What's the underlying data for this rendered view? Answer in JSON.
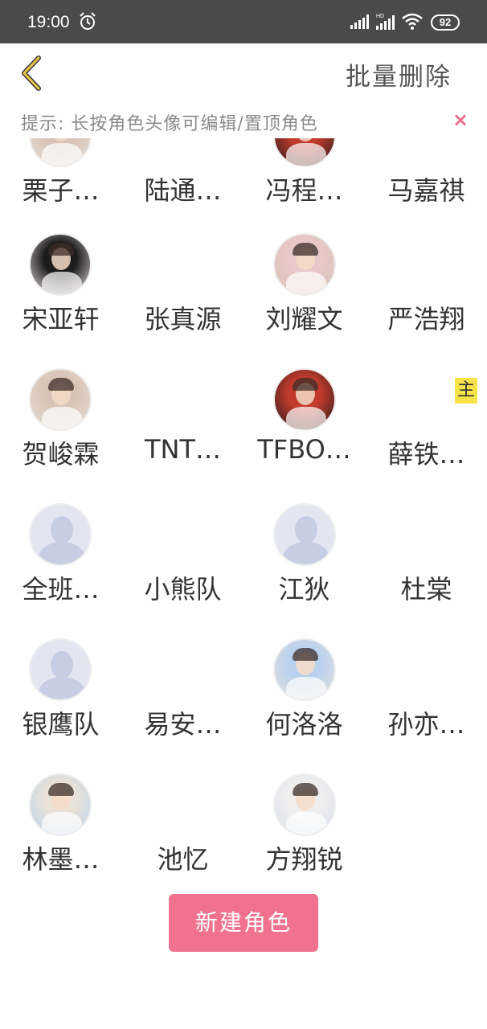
{
  "status_bar": {
    "time": "19:00",
    "battery": "92",
    "alarm_icon": "alarm-clock-icon",
    "signal_icon": "cell-signal-icon",
    "hd_label": "HD",
    "wifi_icon": "wifi-icon"
  },
  "header": {
    "back_icon": "chevron-left-icon",
    "back_color": "#e8c84a",
    "batch_delete_label": "批量删除"
  },
  "tip": {
    "text": "提示: 长按角色头像可编辑/置顶角色",
    "close_symbol": "×",
    "close_color": "#f06f8a"
  },
  "roles": [
    {
      "name": "栗子…",
      "avatar": "photo",
      "badge": ""
    },
    {
      "name": "陆通…",
      "avatar": "photo",
      "badge": ""
    },
    {
      "name": "冯程…",
      "avatar": "photo",
      "badge": ""
    },
    {
      "name": "马嘉祺",
      "avatar": "photo",
      "badge": ""
    },
    {
      "name": "宋亚轩",
      "avatar": "photo",
      "badge": ""
    },
    {
      "name": "张真源",
      "avatar": "photo",
      "badge": ""
    },
    {
      "name": "刘耀文",
      "avatar": "photo",
      "badge": ""
    },
    {
      "name": "严浩翔",
      "avatar": "photo",
      "badge": ""
    },
    {
      "name": "贺峻霖",
      "avatar": "photo",
      "badge": ""
    },
    {
      "name": "TNT…",
      "avatar": "photo",
      "badge": ""
    },
    {
      "name": "TFBO…",
      "avatar": "photo",
      "badge": "主"
    },
    {
      "name": "薛铁…",
      "avatar": "default",
      "badge": ""
    },
    {
      "name": "全班…",
      "avatar": "default",
      "badge": ""
    },
    {
      "name": "小熊队",
      "avatar": "default",
      "badge": ""
    },
    {
      "name": "江狄",
      "avatar": "default",
      "badge": ""
    },
    {
      "name": "杜棠",
      "avatar": "default",
      "badge": ""
    },
    {
      "name": "银鹰队",
      "avatar": "default",
      "badge": ""
    },
    {
      "name": "易安…",
      "avatar": "illustration",
      "badge": ""
    },
    {
      "name": "何洛洛",
      "avatar": "illustration",
      "badge": ""
    },
    {
      "name": "孙亦…",
      "avatar": "illustration",
      "badge": ""
    },
    {
      "name": "林墨…",
      "avatar": "illustration",
      "badge": ""
    },
    {
      "name": "池忆",
      "avatar": "illustration",
      "badge": ""
    },
    {
      "name": "方翔锐",
      "avatar": "illustration",
      "badge": ""
    }
  ],
  "new_role_button": {
    "label": "新建角色",
    "color": "#f0728e"
  }
}
